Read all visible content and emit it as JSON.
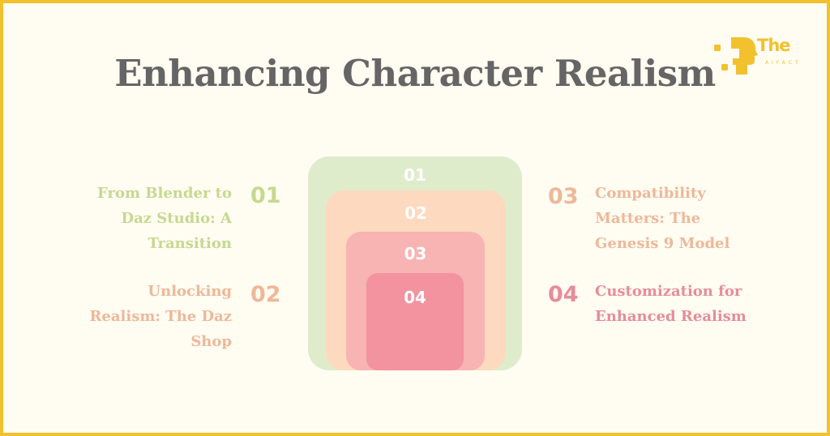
{
  "title": "Enhancing Character Realism",
  "logo": {
    "main": "The",
    "sub": "AIFACT",
    "color": "#f2c12e"
  },
  "colors": {
    "border": "#f2c12e",
    "background": "#fffcf2",
    "title": "#666565"
  },
  "boxes": [
    {
      "label": "01",
      "color": "#dfeccc"
    },
    {
      "label": "02",
      "color": "#fcd9bf"
    },
    {
      "label": "03",
      "color": "#f8b3b3"
    },
    {
      "label": "04",
      "color": "#f2939f"
    }
  ],
  "items": [
    {
      "num": "01",
      "text": [
        "From Blender to",
        "Daz Studio: A",
        "Transition"
      ],
      "color": "#c5d98f",
      "side": "left"
    },
    {
      "num": "02",
      "text": [
        "Unlocking",
        "Realism: The Daz",
        "Shop"
      ],
      "color": "#eeb898",
      "side": "left"
    },
    {
      "num": "03",
      "text": [
        "Compatibility",
        "Matters: The",
        "Genesis 9 Model"
      ],
      "color": "#eeb898",
      "side": "right"
    },
    {
      "num": "04",
      "text": [
        "Customization for",
        "Enhanced Realism"
      ],
      "color": "#e68d99",
      "side": "right"
    }
  ]
}
